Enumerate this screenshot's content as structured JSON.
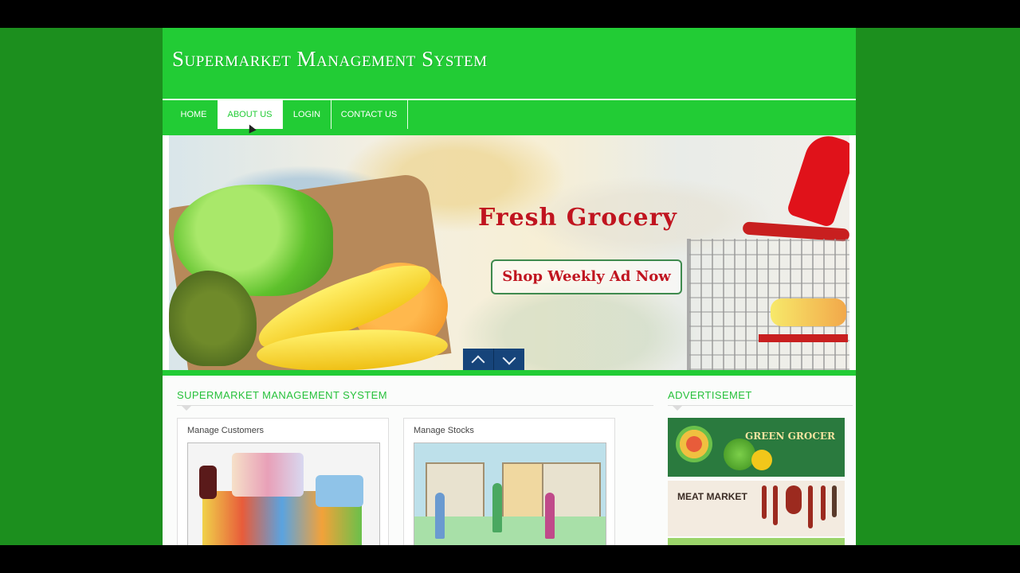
{
  "site": {
    "title": "Supermarket Management System"
  },
  "nav": {
    "items": [
      "HOME",
      "ABOUT US",
      "LOGIN",
      "CONTACT US"
    ],
    "active_index": 1
  },
  "hero": {
    "headline": "Fresh Grocery",
    "cta": "Shop Weekly Ad Now"
  },
  "main": {
    "section_title": "SUPERMARKET MANAGEMENT SYSTEM",
    "cards": [
      {
        "title": "Manage Customers"
      },
      {
        "title": "Manage Stocks"
      }
    ]
  },
  "sidebar": {
    "title": "ADVERTISEMET",
    "ads": [
      {
        "label": "GREEN GROCER"
      },
      {
        "label": "MEAT MARKET"
      }
    ]
  },
  "colors": {
    "outer_bg": "#1c8f1e",
    "header_green": "#22cc35",
    "accent_red": "#c0141f",
    "slider_btn": "#16447a"
  },
  "icons": {
    "prev": "chevron-up-icon",
    "next": "chevron-down-icon"
  }
}
